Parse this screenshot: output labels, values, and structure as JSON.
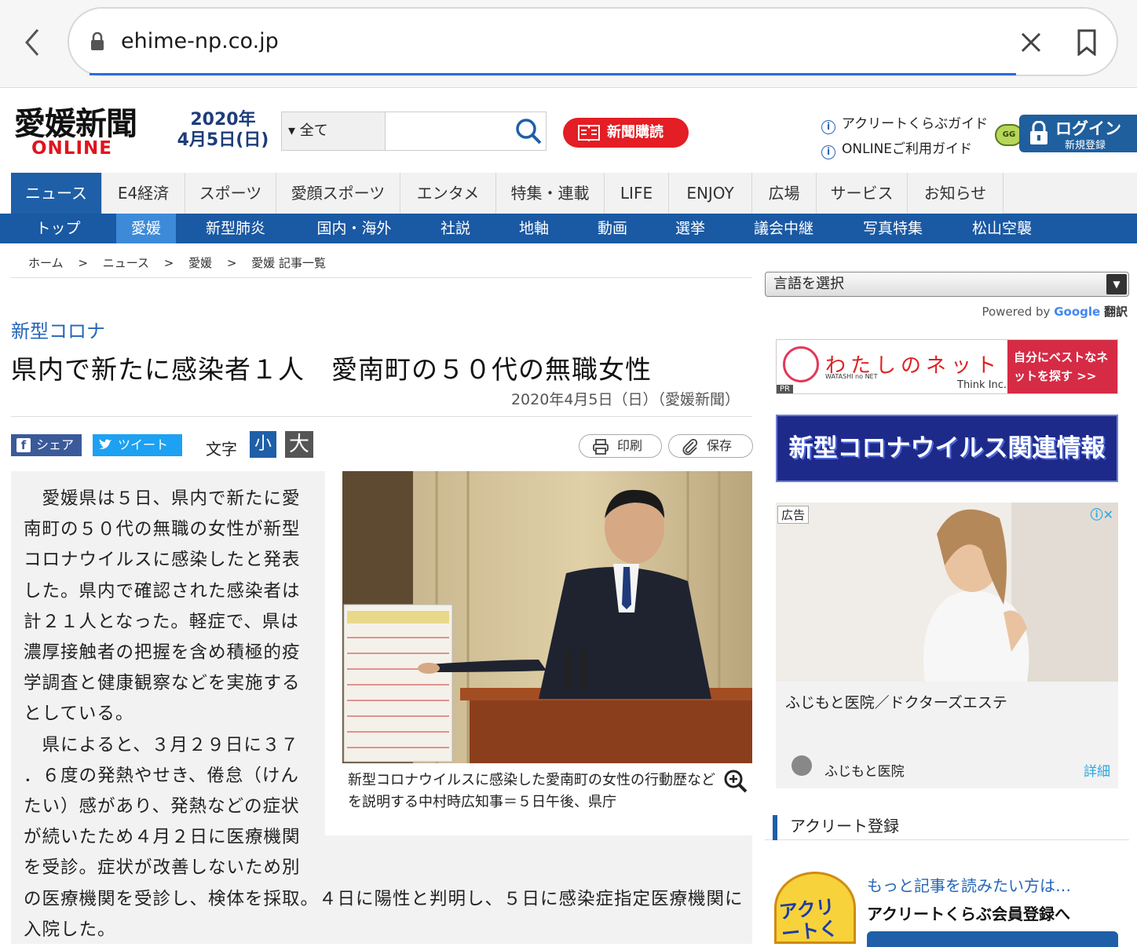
{
  "browser": {
    "url": "ehime-np.co.jp"
  },
  "site": {
    "logo_main": "愛媛新聞",
    "logo_sub": "ONLINE",
    "date_year": "2020年",
    "date_day": "4月5日(日)",
    "search_category": "▾ 全て",
    "subscribe_label": "新聞購読",
    "guide1": "アクリートくらぶガイド",
    "guide2": "ONLINEご利用ガイド",
    "login_label": "ログイン",
    "register_label": "新規登録"
  },
  "nav_main": [
    "ニュース",
    "E4経済",
    "スポーツ",
    "愛顔スポーツ",
    "エンタメ",
    "特集・連載",
    "LIFE",
    "ENJOY",
    "広場",
    "サービス",
    "お知らせ"
  ],
  "nav_sub": [
    "トップ",
    "愛媛",
    "新型肺炎",
    "国内・海外",
    "社説",
    "地軸",
    "動画",
    "選挙",
    "議会中継",
    "写真特集",
    "松山空襲"
  ],
  "breadcrumb": [
    "ホーム",
    ">",
    "ニュース",
    ">",
    "愛媛",
    ">",
    "愛媛 記事一覧"
  ],
  "article": {
    "kicker": "新型コロナ",
    "headline": "県内で新たに感染者１人　愛南町の５０代の無職女性",
    "byline": "2020年4月5日（日）（愛媛新聞）",
    "share_label": "シェア",
    "tweet_label": "ツイート",
    "font_label": "文字",
    "font_small": "小",
    "font_large": "大",
    "print_label": "印刷",
    "save_label": "保存",
    "body_lines": [
      "　愛媛県は５日、県内で新たに愛",
      "南町の５０代の無職の女性が新型",
      "コロナウイルスに感染したと発表",
      "した。県内で確認された感染者は",
      "計２１人となった。軽症で、県は",
      "濃厚接触者の把握を含め積極的疫",
      "学調査と健康観察などを実施する",
      "としている。",
      "　県によると、３月２９日に３７",
      "．６度の発熱やせき、倦怠（けん",
      "たい）感があり、発熱などの症状",
      "が続いたため４月２日に医療機関",
      "を受診。症状が改善しないため別",
      "の医療機関を受診し、検体を採取。４日に陽性と判明し、５日に感染症指定医療機関に",
      "入院した。"
    ],
    "caption": "新型コロナウイルスに感染した愛南町の女性の行動歴などを説明する中村時広知事＝５日午後、県庁"
  },
  "sidebar": {
    "language_select": "言語を選択",
    "powered_by": "Powered by",
    "google": "Google",
    "translate": "翻訳",
    "ad1_name": "わたしのネット",
    "ad1_sub": "WATASHI no NET",
    "ad1_company": "Think Inc.",
    "ad1_cta": "自分にベストなネットを探す >>",
    "ad1_pr": "PR",
    "covid_banner": "新型コロナウイルス関連情報",
    "ad2_tag": "広告",
    "ad2_title": "ふじもと医院／ドクターズエステ",
    "ad2_advertiser": "ふじもと医院",
    "ad2_more": "詳細",
    "acreet_heading": "アクリート登録",
    "more_articles": "もっと記事を読みたい方は…",
    "join_label": "アクリートくらぶ会員登録へ",
    "mascot_text": "アクリートくらぶ"
  },
  "colors": {
    "brand_blue": "#1a59a3",
    "accent_red": "#e31e24",
    "link_blue": "#2566b8"
  }
}
